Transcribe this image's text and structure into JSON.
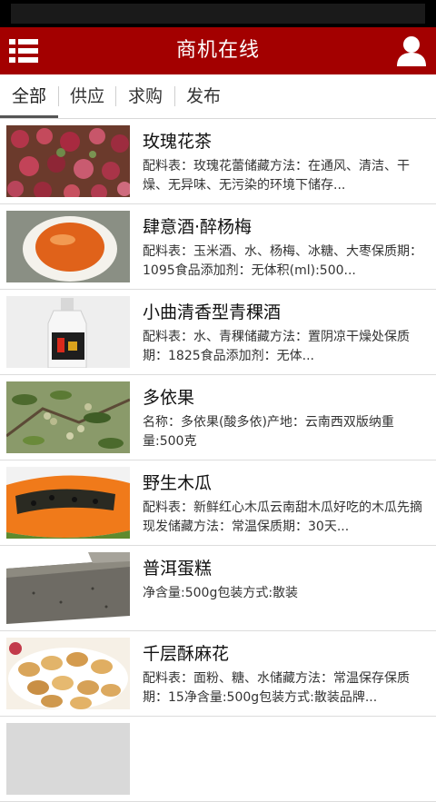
{
  "app": {
    "title": "商机在线"
  },
  "icons": {
    "menu": "list-menu-icon",
    "user": "user-icon"
  },
  "colors": {
    "header": "#a30000"
  },
  "tabs": [
    "全部",
    "供应",
    "求购",
    "发布"
  ],
  "items": [
    {
      "title": "玫瑰花茶",
      "desc": "配料表：玫瑰花蕾储藏方法：在通风、清洁、干燥、无异味、无污染的环境下储存..."
    },
    {
      "title": "肆意酒·醉杨梅",
      "desc": "配料表：玉米酒、水、杨梅、冰糖、大枣保质期：1095食品添加剂：无体积(ml):500..."
    },
    {
      "title": "小曲清香型青稞酒",
      "desc": "配料表：水、青稞储藏方法：置阴凉干燥处保质期：1825食品添加剂：无体..."
    },
    {
      "title": "多依果",
      "desc": "名称：多依果(酸多依)产地：云南西双版纳重量:500克"
    },
    {
      "title": "野生木瓜",
      "desc": "配料表：新鲜红心木瓜云南甜木瓜好吃的木瓜先摘现发储藏方法：常温保质期：30天..."
    },
    {
      "title": "普洱蛋糕",
      "desc": "净含量:500g包装方式:散装"
    },
    {
      "title": "千层酥麻花",
      "desc": "配料表：面粉、糖、水储藏方法：常温保存保质期：15净含量:500g包装方式:散装品牌..."
    }
  ]
}
